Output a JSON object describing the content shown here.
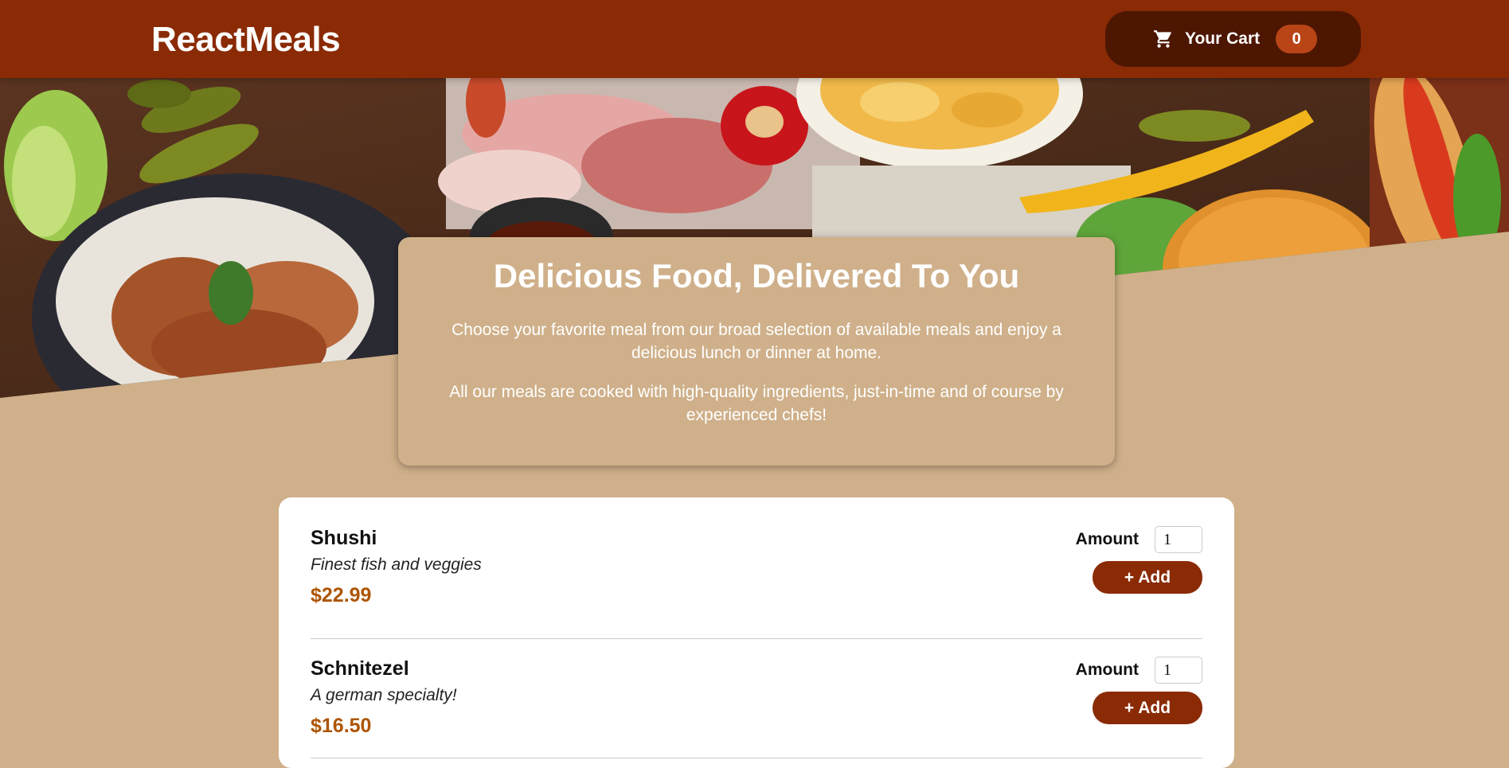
{
  "header": {
    "logo": "ReactMeals",
    "cart": {
      "label": "Your Cart",
      "count": "0",
      "icon": "cart-icon"
    },
    "bg_color": "#8a2b06"
  },
  "hero": {
    "image": "assorted-food-table-photo"
  },
  "summary": {
    "title": "Delicious Food, Delivered To You",
    "paragraph1": "Choose your favorite meal from our broad selection of available meals and enjoy a delicious lunch or dinner at home.",
    "paragraph2": "All our meals are cooked with high-quality ingredients, just-in-time and of course by experienced chefs!"
  },
  "meals": [
    {
      "name": "Shushi",
      "description": "Finest fish and veggies",
      "price": "$22.99",
      "amount_label": "Amount",
      "amount": "1",
      "add_label": "+ Add"
    },
    {
      "name": "Schnitezel",
      "description": "A german specialty!",
      "price": "$16.50",
      "amount_label": "Amount",
      "amount": "1",
      "add_label": "+ Add"
    }
  ],
  "colors": {
    "accent": "#8a2b06",
    "price": "#ad5502",
    "background": "#cfb08a",
    "badge": "#b94517"
  }
}
